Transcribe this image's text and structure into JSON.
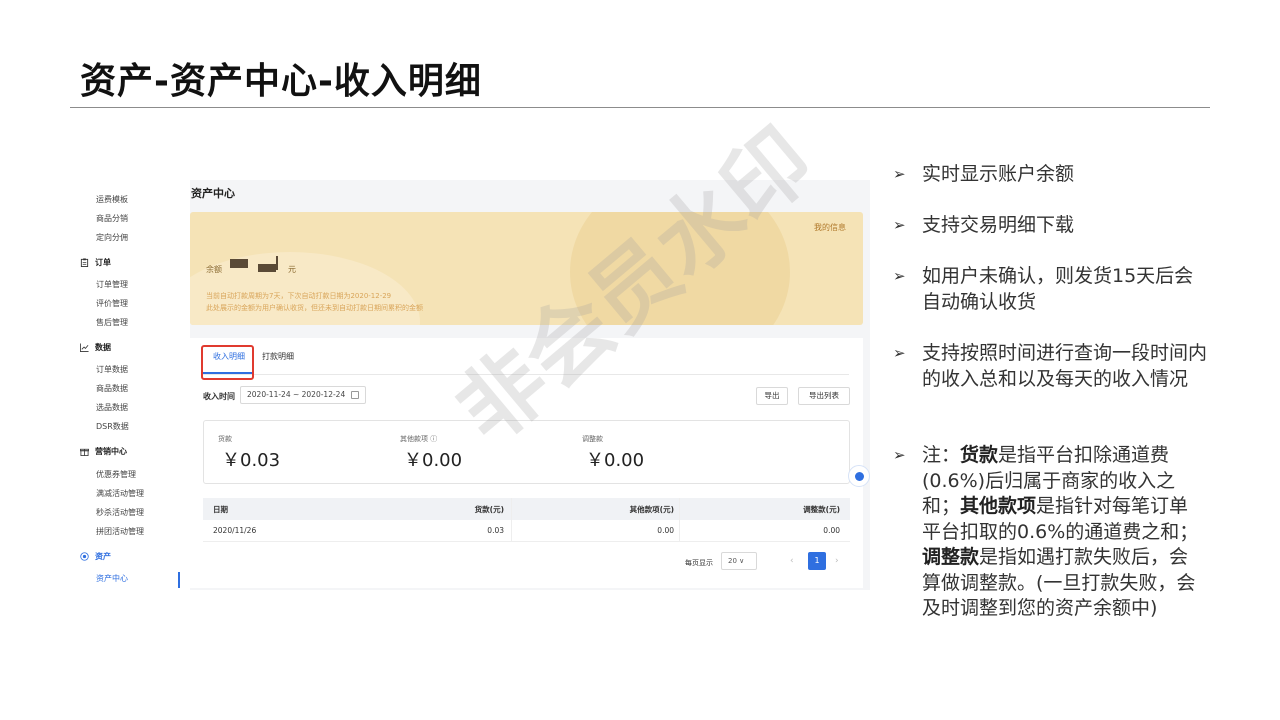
{
  "slide": {
    "title": "资产-资产中心-收入明细"
  },
  "sidebar": {
    "items": [
      {
        "label": "运费模板"
      },
      {
        "label": "商品分销"
      },
      {
        "label": "定向分佣"
      }
    ],
    "groups": [
      {
        "label": "订单",
        "icon": "clipboard-icon",
        "items": [
          "订单管理",
          "评价管理",
          "售后管理"
        ]
      },
      {
        "label": "数据",
        "icon": "chart-icon",
        "items": [
          "订单数据",
          "商品数据",
          "选品数据",
          "DSR数据"
        ]
      },
      {
        "label": "营销中心",
        "icon": "gift-icon",
        "items": [
          "优惠券管理",
          "满减活动管理",
          "秒杀活动管理",
          "拼团活动管理"
        ]
      },
      {
        "label": "资产",
        "icon": "target-icon",
        "items": [
          "资产中心"
        ]
      }
    ]
  },
  "page": {
    "title": "资产中心",
    "my_info": "我的信息",
    "balance_label": "余额",
    "balance_unit": "元",
    "notice_line1": "当前自动打款周期为7天，下次自动打款日期为2020-12-29",
    "notice_line2": "此处展示的金额为用户确认收货，但还未到自动打款日期间累积的金额"
  },
  "tabs": [
    {
      "label": "收入明细",
      "active": true
    },
    {
      "label": "打款明细",
      "active": false
    }
  ],
  "filter": {
    "label": "收入时间",
    "date_range": "2020-11-24 ~ 2020-12-24",
    "export": "导出",
    "export_list": "导出列表"
  },
  "stats": [
    {
      "label": "货款",
      "value": "￥0.03"
    },
    {
      "label": "其他款项 ⓘ",
      "value": "￥0.00"
    },
    {
      "label": "调整款",
      "value": "￥0.00"
    }
  ],
  "table": {
    "columns": [
      "日期",
      "货款(元)",
      "其他款项(元)",
      "调整款(元)"
    ],
    "rows": [
      [
        "2020/11/26",
        "0.03",
        "0.00",
        "0.00"
      ]
    ]
  },
  "pagination": {
    "per_page_label": "每页显示",
    "page_size": "20 ∨",
    "prev": "‹",
    "current": "1",
    "next": "›"
  },
  "watermark": "非会员水印",
  "bullets": {
    "b1": "实时显示账户余额",
    "b2": "支持交易明细下载",
    "b3": "如用户未确认，则发货15天后会自动确认收货",
    "b4": "支持按照时间进行查询一段时间内的收入总和以及每天的收入情况",
    "b5_prefix": "注：",
    "b5_term1": "货款",
    "b5_text1": "是指平台扣除通道费(0.6%)后归属于商家的收入之和；",
    "b5_term2": "其他款项",
    "b5_text2": "是指针对每笔订单平台扣取的0.6%的通道费之和；",
    "b5_term3": "调整款",
    "b5_text3": "是指如遇打款失败后，会算做调整款。(一旦打款失败，会及时调整到您的资产余额中)"
  }
}
